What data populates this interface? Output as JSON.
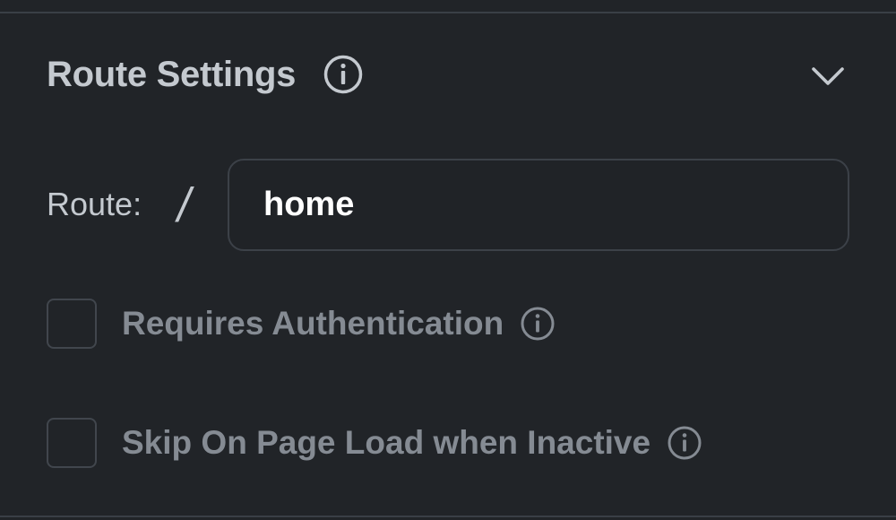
{
  "header": {
    "title": "Route Settings",
    "info_icon": "info-circle-icon",
    "collapse_icon": "chevron-down-icon"
  },
  "route": {
    "label": "Route:",
    "prefix": "/",
    "value": "home"
  },
  "options": [
    {
      "label": "Requires Authentication",
      "checked": false,
      "info_icon": "info-circle-icon"
    },
    {
      "label": "Skip On Page Load when Inactive",
      "checked": false,
      "info_icon": "info-circle-icon"
    }
  ],
  "colors": {
    "background": "#212428",
    "border": "#3a3f46",
    "title_text": "#c4c9cf",
    "muted_text": "#858b93",
    "input_text": "#ffffff"
  }
}
